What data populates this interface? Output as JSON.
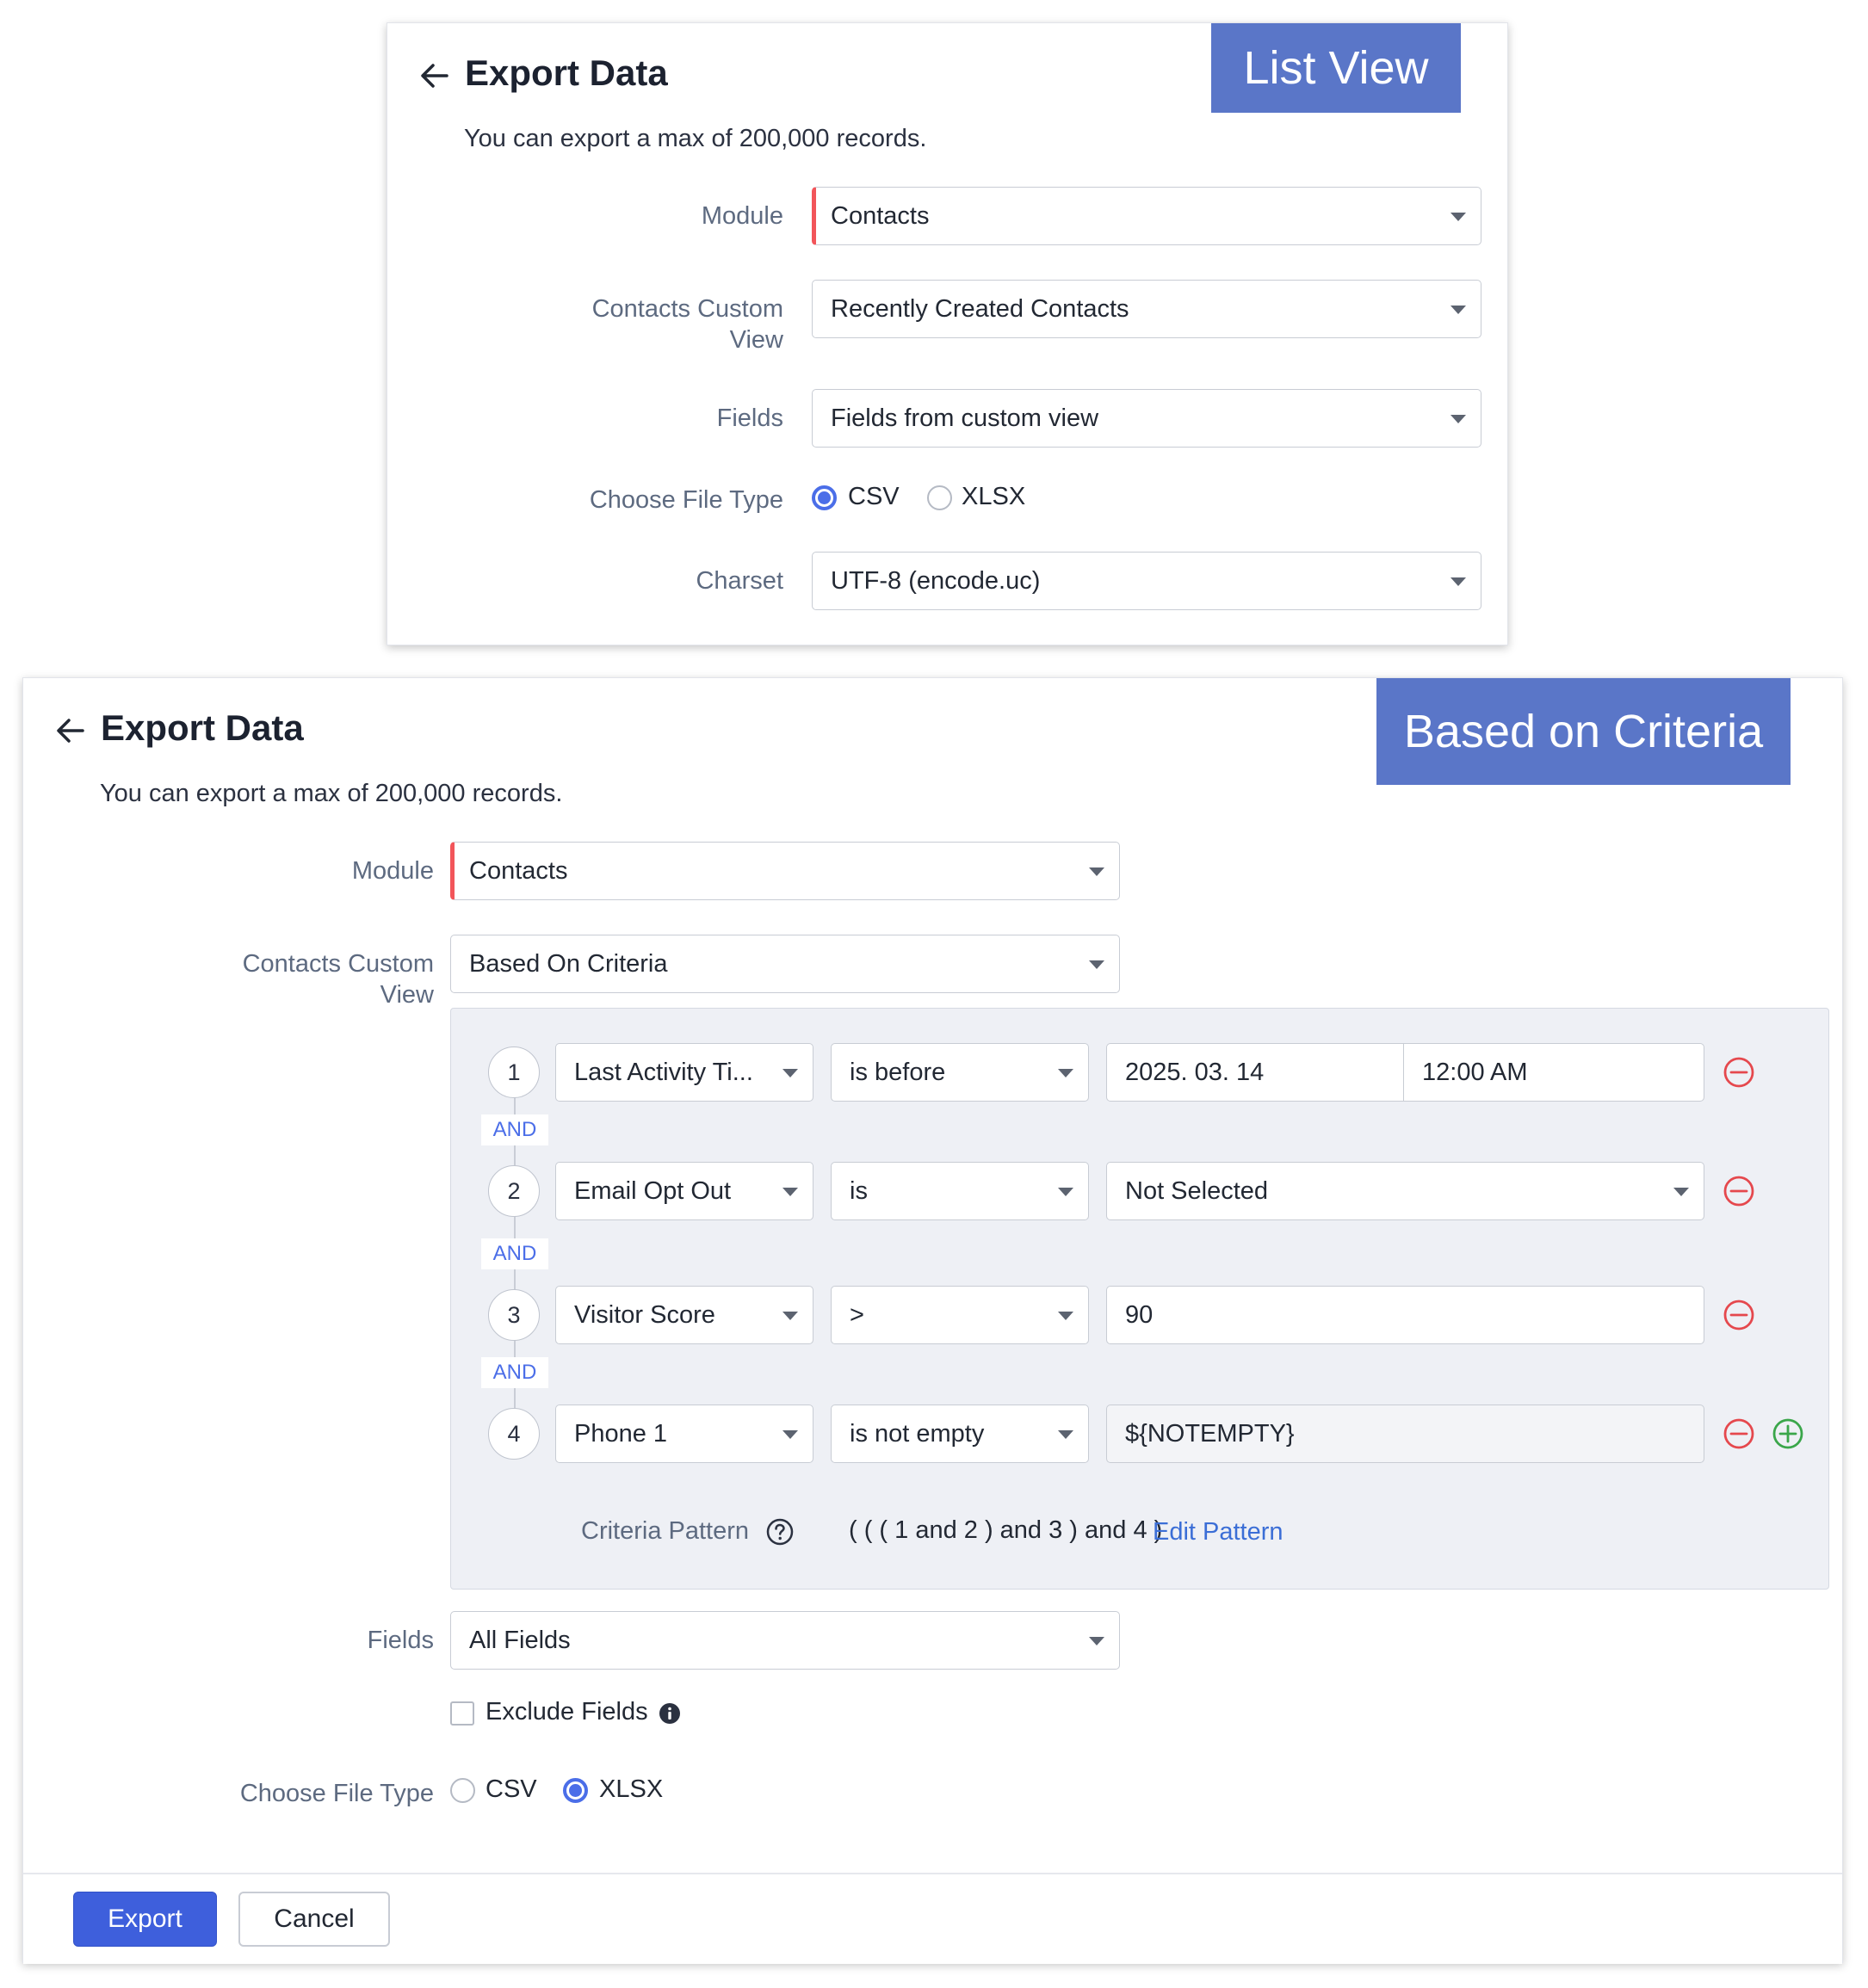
{
  "list_view": {
    "banner": "List View",
    "title": "Export Data",
    "subtitle": "You can export a max of 200,000 records.",
    "module_label": "Module",
    "module_value": "Contacts",
    "custom_view_label_1": "Contacts Custom",
    "custom_view_label_2": "View",
    "custom_view_value": "Recently Created Contacts",
    "fields_label": "Fields",
    "fields_value": "Fields from custom view",
    "file_type_label": "Choose File Type",
    "file_type_options": [
      "CSV",
      "XLSX"
    ],
    "file_type_selected": "CSV",
    "charset_label": "Charset",
    "charset_value": "UTF-8 (encode.uc)"
  },
  "criteria_view": {
    "banner": "Based on Criteria",
    "title": "Export Data",
    "subtitle": "You can export a max of 200,000 records.",
    "module_label": "Module",
    "module_value": "Contacts",
    "custom_view_label_1": "Contacts Custom",
    "custom_view_label_2": "View",
    "custom_view_value": "Based On Criteria",
    "criteria": [
      {
        "num": "1",
        "field": "Last Activity Ti...",
        "operator": "is before",
        "value": "2025. 03. 14",
        "time": "12:00 AM"
      },
      {
        "num": "2",
        "field": "Email Opt Out",
        "operator": "is",
        "value": "Not Selected"
      },
      {
        "num": "3",
        "field": "Visitor Score",
        "operator": ">",
        "value": "90"
      },
      {
        "num": "4",
        "field": "Phone 1",
        "operator": "is not empty",
        "value": "${NOTEMPTY}"
      }
    ],
    "and_label": "AND",
    "criteria_pattern_label": "Criteria Pattern",
    "criteria_pattern": "( ( ( 1 and 2 ) and 3 ) and 4 )",
    "edit_pattern": "Edit Pattern",
    "fields_label": "Fields",
    "fields_value": "All Fields",
    "exclude_fields": "Exclude Fields",
    "file_type_label": "Choose File Type",
    "file_type_options": [
      "CSV",
      "XLSX"
    ],
    "file_type_selected": "XLSX",
    "export_button": "Export",
    "cancel_button": "Cancel"
  },
  "colors": {
    "banner": "#5a76c8",
    "primary": "#3e5fdc",
    "accent_radio": "#4b6ee8",
    "remove": "#e5484d",
    "add": "#3aa64a",
    "required": "#f2555a"
  },
  "icons": [
    "arrow-left-icon",
    "chevron-down-icon",
    "minus-circle-icon",
    "plus-circle-icon",
    "help-circle-icon",
    "info-icon"
  ]
}
